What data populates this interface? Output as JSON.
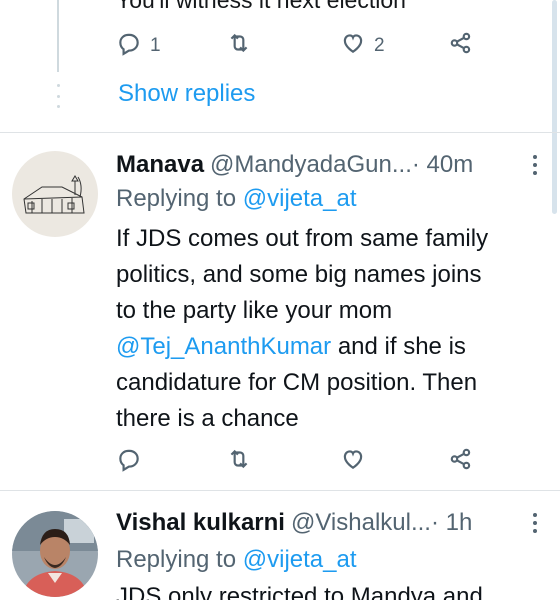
{
  "top_fragment": {
    "text": "You'll witness it next election",
    "reply_count": "1",
    "like_count": "2",
    "show_replies": "Show replies"
  },
  "tweets": [
    {
      "name": "Manava",
      "handle": "@MandyadaGun...",
      "time": " · 40m",
      "replying_prefix": "Replying to ",
      "replying_to": "@vijeta_at",
      "lines": [
        "If JDS comes out from same family",
        "politics, and some big names joins",
        "to the party like your mom"
      ],
      "mention": "@Tej_AnanthKumar",
      "after_mention": " and if she is",
      "lines2": [
        "candidature for CM position. Then",
        "there is a chance"
      ]
    },
    {
      "name": "Vishal kulkarni",
      "handle": "@Vishalkul...",
      "time": " · 1h",
      "replying_prefix": "Replying to ",
      "replying_to": "@vijeta_at",
      "partial_line": "JDS only restricted to Mandya and"
    }
  ],
  "icons": {
    "reply": "reply-icon",
    "retweet": "retweet-icon",
    "like": "heart-icon",
    "share": "share-icon",
    "more": "more-vertical-icon"
  },
  "colors": {
    "accent": "#1d9bf0",
    "secondary_text": "#536471",
    "divider": "#dfe3e6"
  }
}
